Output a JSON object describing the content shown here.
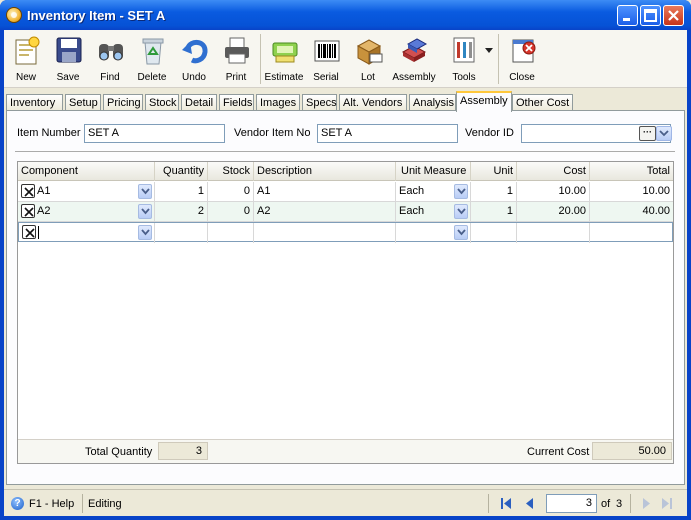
{
  "window": {
    "title": "Inventory Item - SET A"
  },
  "toolbar": {
    "new": "New",
    "save": "Save",
    "find": "Find",
    "delete": "Delete",
    "undo": "Undo",
    "print": "Print",
    "estimate": "Estimate",
    "serial": "Serial",
    "lot": "Lot",
    "assembly": "Assembly",
    "tools": "Tools",
    "close": "Close"
  },
  "tabs": [
    "Inventory",
    "Setup",
    "Pricing",
    "Stock",
    "Detail",
    "Fields",
    "Images",
    "Specs",
    "Alt. Vendors",
    "Analysis",
    "Assembly",
    "Other Cost"
  ],
  "active_tab": "Assembly",
  "form": {
    "item_number_label": "Item Number",
    "item_number_value": "SET A",
    "vendor_item_no_label": "Vendor Item No",
    "vendor_item_no_value": "SET A",
    "vendor_id_label": "Vendor ID",
    "vendor_id_value": ""
  },
  "grid": {
    "columns": [
      "Component",
      "Quantity",
      "Stock",
      "Description",
      "Unit Measure",
      "Unit",
      "Cost",
      "Total"
    ],
    "rows": [
      {
        "component": "A1",
        "quantity": "1",
        "stock": "0",
        "description": "A1",
        "unit_measure": "Each",
        "unit": "1",
        "cost": "10.00",
        "total": "10.00"
      },
      {
        "component": "A2",
        "quantity": "2",
        "stock": "0",
        "description": "A2",
        "unit_measure": "Each",
        "unit": "1",
        "cost": "20.00",
        "total": "40.00"
      }
    ]
  },
  "totals": {
    "total_quantity_label": "Total Quantity",
    "total_quantity_value": "3",
    "current_cost_label": "Current Cost",
    "current_cost_value": "50.00"
  },
  "status": {
    "help": "F1 - Help",
    "mode": "Editing",
    "record": "3",
    "of_label": "of",
    "record_total": "3"
  },
  "colors": {
    "title_bar": "#0a5be0",
    "active_tab_accent": "#ffc83c",
    "alt_row": "#eef7f1"
  }
}
